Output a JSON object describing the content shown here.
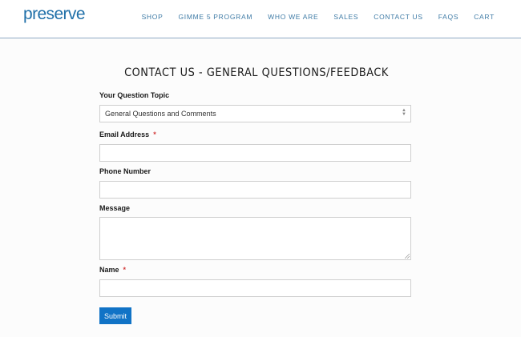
{
  "brand": {
    "logo_text": "preserve"
  },
  "nav": {
    "items": [
      "SHOP",
      "GIMME 5 PROGRAM",
      "WHO WE ARE",
      "SALES",
      "CONTACT US",
      "FAQS",
      "CART"
    ]
  },
  "page": {
    "title": "CONTACT US - GENERAL QUESTIONS/FEEDBACK"
  },
  "form": {
    "topic_label": "Your Question Topic",
    "topic_value": "General Questions and Comments",
    "email_label": "Email Address",
    "email_required": "*",
    "phone_label": "Phone Number",
    "message_label": "Message",
    "name_label": "Name",
    "name_required": "*",
    "submit_label": "Submit"
  },
  "colors": {
    "brand": "#1f6fa8",
    "nav": "#3f7ba6",
    "button": "#1173c6",
    "required": "#d23a3a"
  }
}
